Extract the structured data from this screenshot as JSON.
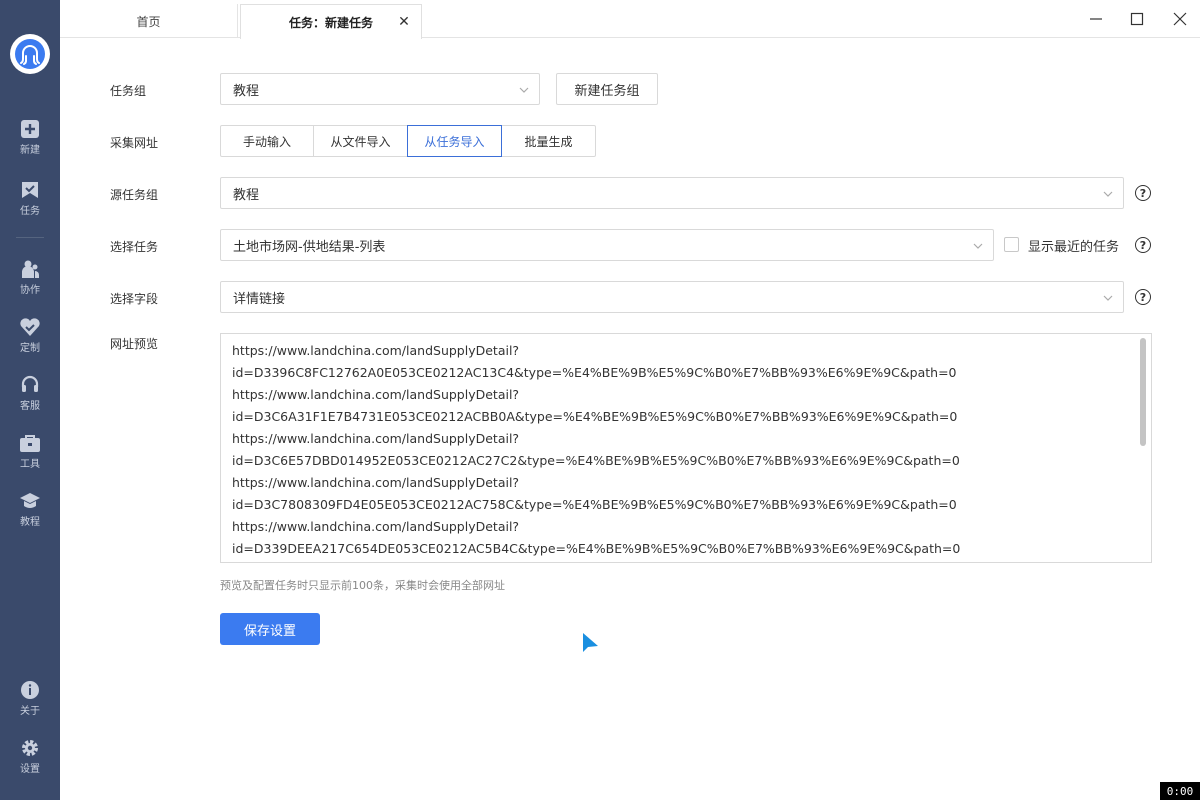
{
  "sidebar": {
    "items": [
      {
        "label": "新建",
        "icon": "plus-square-icon"
      },
      {
        "label": "任务",
        "icon": "task-flag-icon"
      },
      {
        "label": "协作",
        "icon": "collaborate-icon"
      },
      {
        "label": "定制",
        "icon": "heart-check-icon"
      },
      {
        "label": "客服",
        "icon": "headset-icon"
      },
      {
        "label": "工具",
        "icon": "toolbox-icon"
      },
      {
        "label": "教程",
        "icon": "graduation-cap-icon"
      }
    ],
    "bottom_items": [
      {
        "label": "关于",
        "icon": "info-icon"
      },
      {
        "label": "设置",
        "icon": "gear-icon"
      }
    ]
  },
  "tabs": {
    "home": "首页",
    "active": "任务：新建任务",
    "close_symbol": "✕"
  },
  "form": {
    "task_group_label": "任务组",
    "task_group_value": "教程",
    "new_group_button": "新建任务组",
    "collect_url_label": "采集网址",
    "segments": [
      "手动输入",
      "从文件导入",
      "从任务导入",
      "批量生成"
    ],
    "active_segment": "从任务导入",
    "source_group_label": "源任务组",
    "source_group_value": "教程",
    "select_task_label": "选择任务",
    "select_task_value": "土地市场网-供地结果-列表",
    "show_recent_label": "显示最近的任务",
    "select_field_label": "选择字段",
    "select_field_value": "详情链接",
    "url_preview_label": "网址预览",
    "url_lines": [
      "https://www.landchina.com/landSupplyDetail?",
      "id=D3396C8FC12762A0E053CE0212AC13C4&type=%E4%BE%9B%E5%9C%B0%E7%BB%93%E6%9E%9C&path=0",
      "https://www.landchina.com/landSupplyDetail?",
      "id=D3C6A31F1E7B4731E053CE0212ACBB0A&type=%E4%BE%9B%E5%9C%B0%E7%BB%93%E6%9E%9C&path=0",
      "https://www.landchina.com/landSupplyDetail?",
      "id=D3C6E57DBD014952E053CE0212AC27C2&type=%E4%BE%9B%E5%9C%B0%E7%BB%93%E6%9E%9C&path=0",
      "https://www.landchina.com/landSupplyDetail?",
      "id=D3C7808309FD4E05E053CE0212AC758C&type=%E4%BE%9B%E5%9C%B0%E7%BB%93%E6%9E%9C&path=0",
      "https://www.landchina.com/landSupplyDetail?",
      "id=D339DEEA217C654DE053CE0212AC5B4C&type=%E4%BE%9B%E5%9C%B0%E7%BB%93%E6%9E%9C&path=0"
    ],
    "hint": "预览及配置任务时只显示前100条，采集时会使用全部网址",
    "save_button": "保存设置"
  },
  "clock": "0:00",
  "colors": {
    "sidebar_bg": "#3a4a6b",
    "accent": "#3b7bf0",
    "active_segment": "#3b6fd8"
  }
}
